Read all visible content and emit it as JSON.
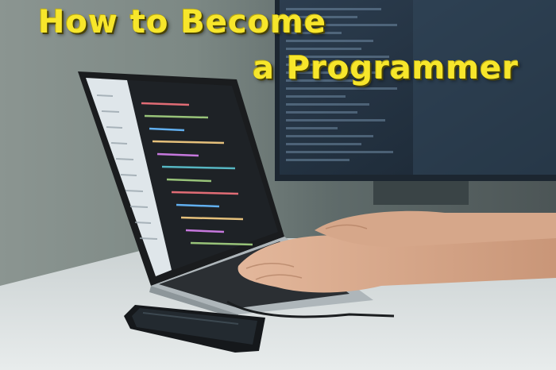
{
  "image": {
    "title_line_1": "How to Become",
    "title_line_2": "a Programmer",
    "title_color": "#f7e62b",
    "scene_objects": [
      "laptop-with-code-editor",
      "external-monitor",
      "hands-typing",
      "smartphone",
      "desk"
    ]
  }
}
